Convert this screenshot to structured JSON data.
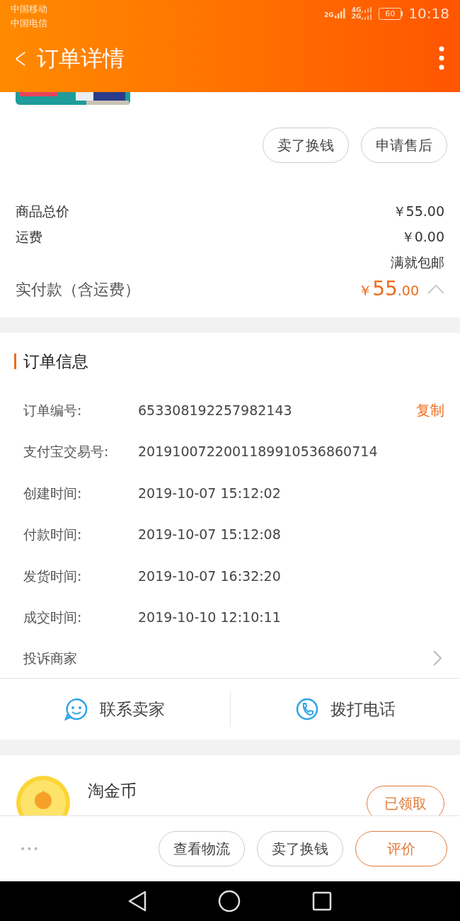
{
  "status_bar": {
    "carriers": [
      "中国移动",
      "中国电信"
    ],
    "network_1": "2G",
    "network_2": "4G",
    "network_3": "2G",
    "battery": "60",
    "time": "10:18"
  },
  "header": {
    "back": "<",
    "title": "订单详情"
  },
  "product": {
    "kind": "picture"
  },
  "product_actions": [
    "卖了换钱",
    "申请售后"
  ],
  "price_summary": {
    "rows": [
      {
        "label": "商品总价",
        "value": "￥55.00"
      },
      {
        "label": "运费",
        "value": "￥0.00"
      }
    ],
    "shipping_note": "满就包邮",
    "paid_label": "实付款（含运费）",
    "paid_currency": "￥",
    "paid_integer": "55",
    "paid_decimal": ".00",
    "expanded": true
  },
  "order_info": {
    "title": "订单信息",
    "rows": [
      {
        "label": "订单编号:",
        "value": "653308192257982143",
        "action": "复制"
      },
      {
        "label": "支付宝交易号:",
        "value": "2019100722001189910536860714"
      },
      {
        "label": "创建时间:",
        "value": "2019-10-07 15:12:02"
      },
      {
        "label": "付款时间:",
        "value": "2019-10-07 15:12:08"
      },
      {
        "label": "发货时间:",
        "value": "2019-10-07 16:32:20"
      },
      {
        "label": "成交时间:",
        "value": "2019-10-10 12:10:11"
      }
    ],
    "complaint": "投诉商家"
  },
  "contact": [
    "联系卖家",
    "拨打电话"
  ],
  "coins": {
    "title": "淘金币",
    "button": "已领取"
  },
  "bottom_bar": {
    "more": "•••",
    "buttons": [
      {
        "label": "查看物流",
        "primary": false
      },
      {
        "label": "卖了换钱",
        "primary": false
      },
      {
        "label": "评价",
        "primary": true
      }
    ]
  }
}
